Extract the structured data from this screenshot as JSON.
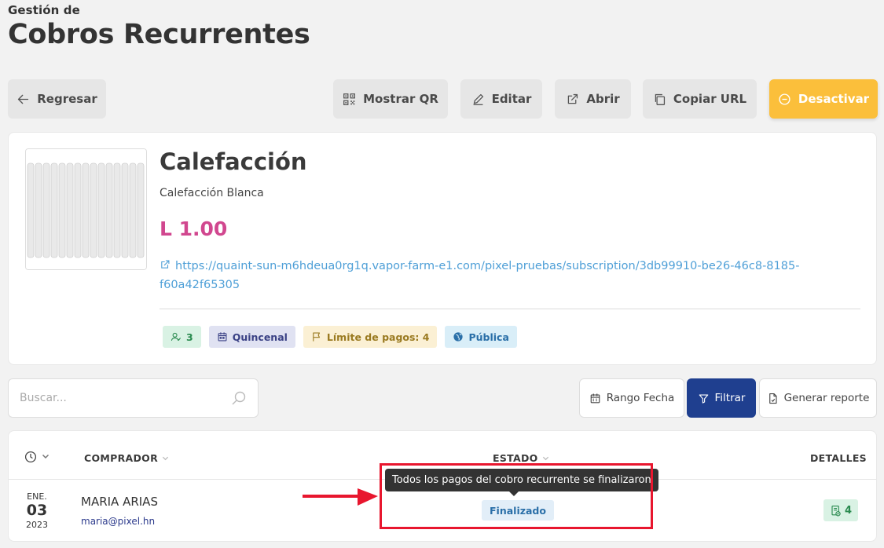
{
  "header": {
    "subtitle": "Gestión de",
    "title": "Cobros Recurrentes"
  },
  "toolbar": {
    "back": "Regresar",
    "show_qr": "Mostrar QR",
    "edit": "Editar",
    "open": "Abrir",
    "copy_url": "Copiar URL",
    "deactivate": "Desactivar"
  },
  "product": {
    "name": "Calefacción",
    "description": "Calefacción Blanca",
    "price": "L 1.00",
    "url_line1": "https://quaint-sun-m6hdeua0rg1q.vapor-farm-e1.com/pixel-pruebas/subscription/3db99910-be26-46c8-8185-",
    "url_line2": "f60a42f65305",
    "tags": {
      "subscribers": "3",
      "frequency": "Quincenal",
      "payment_limit": "Límite de pagos: 4",
      "visibility": "Pública"
    }
  },
  "search": {
    "placeholder": "Buscar...",
    "value": ""
  },
  "filters": {
    "date_range": "Rango Fecha",
    "filter": "Filtrar",
    "report": "Generar reporte"
  },
  "table": {
    "columns": {
      "buyer": "COMPRADOR",
      "status": "ESTADO",
      "details": "DETALLES"
    },
    "rows": [
      {
        "month": "ENE.",
        "day": "03",
        "year": "2023",
        "buyer_name": "MARIA ARIAS",
        "buyer_email": "maria@pixel.hn",
        "status": "Finalizado",
        "details_count": "4"
      }
    ]
  },
  "tooltip": "Todos los pagos del cobro recurrente se finalizaron",
  "colors": {
    "accent_pink": "#d1478f",
    "warning": "#fbbf3b",
    "primary": "#1f3f8f",
    "link": "#4e9fd7",
    "annotation_red": "#e8162e"
  }
}
